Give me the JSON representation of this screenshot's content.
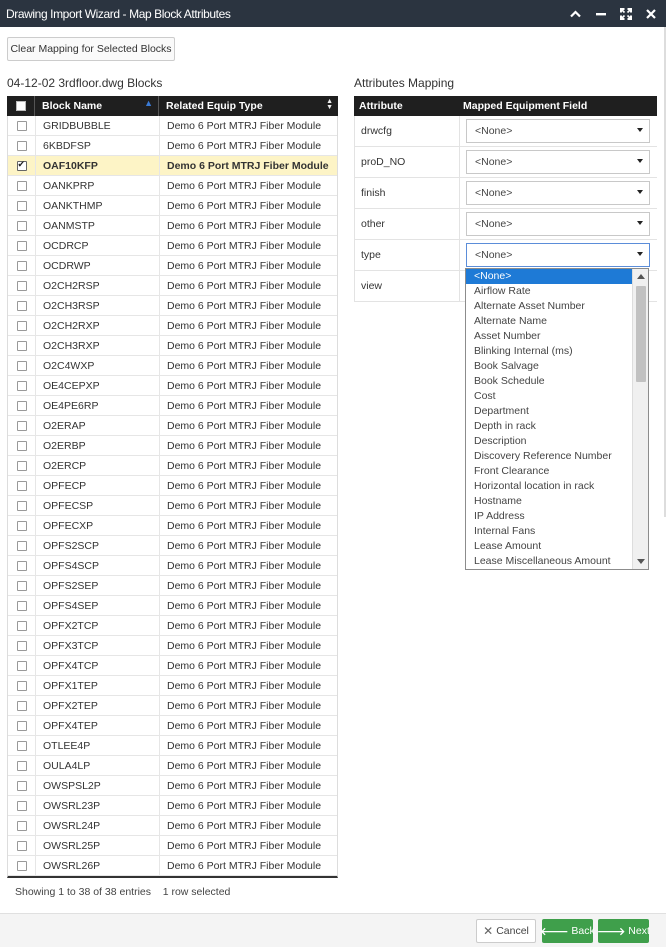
{
  "window": {
    "title": "Drawing Import Wizard - Map Block Attributes"
  },
  "toolbar": {
    "clear_mapping_label": "Clear Mapping for Selected Blocks"
  },
  "blocks": {
    "title": "04-12-02 3rdfloor.dwg Blocks",
    "columns": [
      "Block Name",
      "Related Equip Type"
    ],
    "rows": [
      {
        "name": "GRIDBUBBLE",
        "type": "Demo 6 Port MTRJ Fiber Module",
        "checked": false
      },
      {
        "name": "6KBDFSP",
        "type": "Demo 6 Port MTRJ Fiber Module",
        "checked": false
      },
      {
        "name": "OAF10KFP",
        "type": "Demo 6 Port MTRJ Fiber Module",
        "checked": true
      },
      {
        "name": "OANKPRP",
        "type": "Demo 6 Port MTRJ Fiber Module",
        "checked": false
      },
      {
        "name": "OANKTHMP",
        "type": "Demo 6 Port MTRJ Fiber Module",
        "checked": false
      },
      {
        "name": "OANMSTP",
        "type": "Demo 6 Port MTRJ Fiber Module",
        "checked": false
      },
      {
        "name": "OCDRCP",
        "type": "Demo 6 Port MTRJ Fiber Module",
        "checked": false
      },
      {
        "name": "OCDRWP",
        "type": "Demo 6 Port MTRJ Fiber Module",
        "checked": false
      },
      {
        "name": "O2CH2RSP",
        "type": "Demo 6 Port MTRJ Fiber Module",
        "checked": false
      },
      {
        "name": "O2CH3RSP",
        "type": "Demo 6 Port MTRJ Fiber Module",
        "checked": false
      },
      {
        "name": "O2CH2RXP",
        "type": "Demo 6 Port MTRJ Fiber Module",
        "checked": false
      },
      {
        "name": "O2CH3RXP",
        "type": "Demo 6 Port MTRJ Fiber Module",
        "checked": false
      },
      {
        "name": "O2C4WXP",
        "type": "Demo 6 Port MTRJ Fiber Module",
        "checked": false
      },
      {
        "name": "OE4CEPXP",
        "type": "Demo 6 Port MTRJ Fiber Module",
        "checked": false
      },
      {
        "name": "OE4PE6RP",
        "type": "Demo 6 Port MTRJ Fiber Module",
        "checked": false
      },
      {
        "name": "O2ERAP",
        "type": "Demo 6 Port MTRJ Fiber Module",
        "checked": false
      },
      {
        "name": "O2ERBP",
        "type": "Demo 6 Port MTRJ Fiber Module",
        "checked": false
      },
      {
        "name": "O2ERCP",
        "type": "Demo 6 Port MTRJ Fiber Module",
        "checked": false
      },
      {
        "name": "OPFECP",
        "type": "Demo 6 Port MTRJ Fiber Module",
        "checked": false
      },
      {
        "name": "OPFECSP",
        "type": "Demo 6 Port MTRJ Fiber Module",
        "checked": false
      },
      {
        "name": "OPFECXP",
        "type": "Demo 6 Port MTRJ Fiber Module",
        "checked": false
      },
      {
        "name": "OPFS2SCP",
        "type": "Demo 6 Port MTRJ Fiber Module",
        "checked": false
      },
      {
        "name": "OPFS4SCP",
        "type": "Demo 6 Port MTRJ Fiber Module",
        "checked": false
      },
      {
        "name": "OPFS2SEP",
        "type": "Demo 6 Port MTRJ Fiber Module",
        "checked": false
      },
      {
        "name": "OPFS4SEP",
        "type": "Demo 6 Port MTRJ Fiber Module",
        "checked": false
      },
      {
        "name": "OPFX2TCP",
        "type": "Demo 6 Port MTRJ Fiber Module",
        "checked": false
      },
      {
        "name": "OPFX3TCP",
        "type": "Demo 6 Port MTRJ Fiber Module",
        "checked": false
      },
      {
        "name": "OPFX4TCP",
        "type": "Demo 6 Port MTRJ Fiber Module",
        "checked": false
      },
      {
        "name": "OPFX1TEP",
        "type": "Demo 6 Port MTRJ Fiber Module",
        "checked": false
      },
      {
        "name": "OPFX2TEP",
        "type": "Demo 6 Port MTRJ Fiber Module",
        "checked": false
      },
      {
        "name": "OPFX4TEP",
        "type": "Demo 6 Port MTRJ Fiber Module",
        "checked": false
      },
      {
        "name": "OTLEE4P",
        "type": "Demo 6 Port MTRJ Fiber Module",
        "checked": false
      },
      {
        "name": "OULA4LP",
        "type": "Demo 6 Port MTRJ Fiber Module",
        "checked": false
      },
      {
        "name": "OWSPSL2P",
        "type": "Demo 6 Port MTRJ Fiber Module",
        "checked": false
      },
      {
        "name": "OWSRL23P",
        "type": "Demo 6 Port MTRJ Fiber Module",
        "checked": false
      },
      {
        "name": "OWSRL24P",
        "type": "Demo 6 Port MTRJ Fiber Module",
        "checked": false
      },
      {
        "name": "OWSRL25P",
        "type": "Demo 6 Port MTRJ Fiber Module",
        "checked": false
      },
      {
        "name": "OWSRL26P",
        "type": "Demo 6 Port MTRJ Fiber Module",
        "checked": false
      }
    ],
    "footer_showing": "Showing 1 to 38 of 38 entries",
    "footer_selected": "1 row selected"
  },
  "attributes": {
    "title": "Attributes Mapping",
    "columns": [
      "Attribute",
      "Mapped Equipment Field"
    ],
    "rows": [
      {
        "attribute": "drwcfg",
        "value": "<None>"
      },
      {
        "attribute": "proD_NO",
        "value": "<None>"
      },
      {
        "attribute": "finish",
        "value": "<None>"
      },
      {
        "attribute": "other",
        "value": "<None>"
      },
      {
        "attribute": "type",
        "value": "<None>"
      },
      {
        "attribute": "view",
        "value": ""
      }
    ]
  },
  "dropdown": {
    "options": [
      "<None>",
      "Airflow Rate",
      "Alternate Asset Number",
      "Alternate Name",
      "Asset Number",
      "Blinking Internal (ms)",
      "Book Salvage",
      "Book Schedule",
      "Cost",
      "Department",
      "Depth in rack",
      "Description",
      "Discovery Reference Number",
      "Front Clearance",
      "Horizontal location in rack",
      "Hostname",
      "IP Address",
      "Internal Fans",
      "Lease Amount",
      "Lease Miscellaneous Amount"
    ],
    "highlighted_index": 0
  },
  "buttons": {
    "cancel": "Cancel",
    "back": "Back",
    "next": "Next"
  },
  "colors": {
    "titlebar": "#2b3440",
    "header": "#1f1f1f",
    "selected_row": "#fdf4c6",
    "accent": "#1e7ad6",
    "success": "#3f9f4b"
  }
}
